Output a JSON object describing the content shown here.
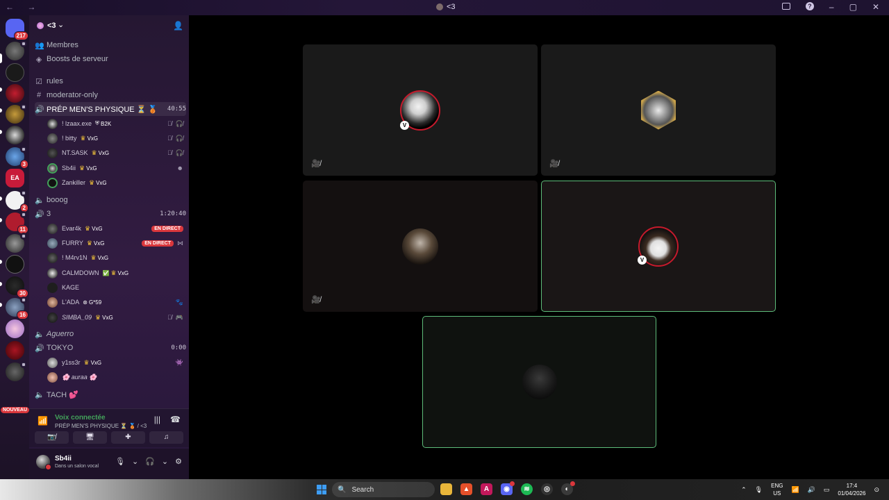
{
  "window": {
    "title": "<3"
  },
  "servers": [
    {
      "name": "home",
      "badge": "217"
    },
    {
      "name": "server-2",
      "badge": ""
    },
    {
      "name": "server-3",
      "badge": ""
    },
    {
      "name": "server-4",
      "badge": ""
    },
    {
      "name": "server-5",
      "badge": ""
    },
    {
      "name": "server-6",
      "badge": ""
    },
    {
      "name": "server-7",
      "badge": "3"
    },
    {
      "name": "server-ea",
      "badge": ""
    },
    {
      "name": "server-9",
      "badge": "2"
    },
    {
      "name": "server-10",
      "badge": "11"
    },
    {
      "name": "server-11",
      "badge": ""
    },
    {
      "name": "server-12",
      "badge": ""
    },
    {
      "name": "server-13",
      "badge": "30"
    },
    {
      "name": "server-14",
      "badge": "16"
    },
    {
      "name": "server-15",
      "badge": ""
    },
    {
      "name": "server-16",
      "badge": ""
    },
    {
      "name": "server-17",
      "badge": ""
    }
  ],
  "new_badge": "NOUVEAU",
  "guild": {
    "name": "<3"
  },
  "channels": {
    "members": "Membres",
    "boosts": "Boosts de serveur",
    "rules": "rules",
    "moderator": "moderator-only",
    "vc1": {
      "name": "PRÉP MEN'S PHYSIQUE ⏳ 🥉",
      "timer": "40:55"
    },
    "vc1_users": [
      {
        "name": "! lzaax.exe",
        "tag": "B2K"
      },
      {
        "name": "! bitty",
        "tag": "VxG"
      },
      {
        "name": "NT.SASK",
        "tag": "VxG"
      },
      {
        "name": "Sb4ii",
        "tag": "VxG"
      },
      {
        "name": "Zankiller",
        "tag": "VxG"
      }
    ],
    "booog": "booog",
    "vc3": {
      "name": "3",
      "timer": "1:20:40"
    },
    "vc3_users": [
      {
        "name": "Evar4k",
        "tag": "VxG",
        "live": "EN DIRECT"
      },
      {
        "name": "FURRY",
        "tag": "VxG",
        "live": "EN DIRECT"
      },
      {
        "name": "! M4rv1N",
        "tag": "VxG"
      },
      {
        "name": "CALMDOWN",
        "tag": "VxG"
      },
      {
        "name": "KAGE",
        "tag": ""
      },
      {
        "name": "L'ADA",
        "tag": "G*59"
      },
      {
        "name": "SIMBA_09",
        "tag": "VxG"
      }
    ],
    "aguerro": "Aguerro",
    "tokyo": {
      "name": "TOKYO",
      "timer": "0:00"
    },
    "tokyo_users": [
      {
        "name": "y1ss3r",
        "tag": "VxG"
      },
      {
        "name": "🌸 auraa 🌸",
        "tag": ""
      }
    ],
    "tach": "TACH 💕"
  },
  "voice": {
    "title": "Voix connectée",
    "subtitle": "PRÉP MEN'S PHYSIQUE ⏳ 🥉 / <3"
  },
  "user": {
    "name": "Sb4ii",
    "status": "Dans un salon vocal"
  },
  "taskbar": {
    "search": "Search",
    "lang1": "ENG",
    "lang2": "US",
    "time": "17:4",
    "date": "01/04/2026"
  },
  "colors": {
    "speaking": "#5ebd7a",
    "live": "#da373c",
    "voice_green": "#43a25a",
    "crown": "#f0c23a"
  }
}
